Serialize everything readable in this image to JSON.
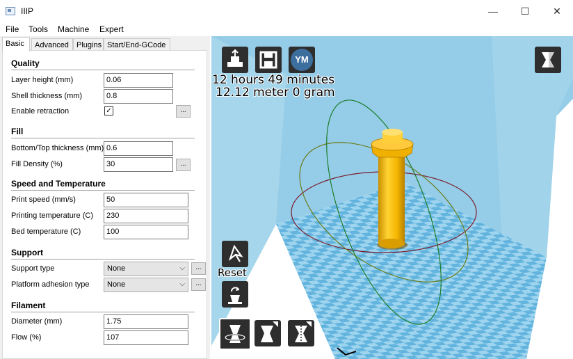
{
  "window": {
    "title": "IIIP",
    "minimize_glyph": "—",
    "maximize_glyph": "☐",
    "close_glyph": "✕"
  },
  "menu": [
    "File",
    "Tools",
    "Machine",
    "Expert"
  ],
  "tabs": [
    "Basic",
    "Advanced",
    "Plugins",
    "Start/End-GCode"
  ],
  "settings": {
    "quality": {
      "heading": "Quality",
      "layer_height": {
        "label": "Layer height (mm)",
        "value": "0.06"
      },
      "shell_thickness": {
        "label": "Shell thickness (mm)",
        "value": "0.8"
      },
      "enable_retraction": {
        "label": "Enable retraction",
        "checked": "✓"
      }
    },
    "fill": {
      "heading": "Fill",
      "bottom_top": {
        "label": "Bottom/Top thickness (mm)",
        "value": "0.6"
      },
      "fill_density": {
        "label": "Fill Density (%)",
        "value": "30"
      }
    },
    "speed": {
      "heading": "Speed and Temperature",
      "print_speed": {
        "label": "Print speed (mm/s)",
        "value": "50"
      },
      "print_temp": {
        "label": "Printing temperature (C)",
        "value": "230"
      },
      "bed_temp": {
        "label": "Bed temperature (C)",
        "value": "100"
      }
    },
    "support": {
      "heading": "Support",
      "support_type": {
        "label": "Support type",
        "value": "None"
      },
      "platform_adhesion": {
        "label": "Platform adhesion type",
        "value": "None"
      }
    },
    "filament": {
      "heading": "Filament",
      "diameter": {
        "label": "Diameter (mm)",
        "value": "1.75"
      },
      "flow": {
        "label": "Flow (%)",
        "value": "107"
      }
    },
    "dots_label": "..."
  },
  "viewport": {
    "print_time": "12 hours 49 minutes",
    "print_amount": "12.12 meter 0 gram",
    "ym_label": "YM",
    "reset_label": "Reset"
  },
  "colors": {
    "build_volume": "#8fc9e6",
    "model": "#f5b800",
    "grid_light": "#9fd4ee",
    "grid_dark": "#62b4de"
  },
  "icons": [
    "load-model-icon",
    "save-gcode-icon",
    "youmagine-icon",
    "view-mode-icon",
    "rotate-icon",
    "lay-flat-icon",
    "scale-icon",
    "mirror-icon"
  ]
}
